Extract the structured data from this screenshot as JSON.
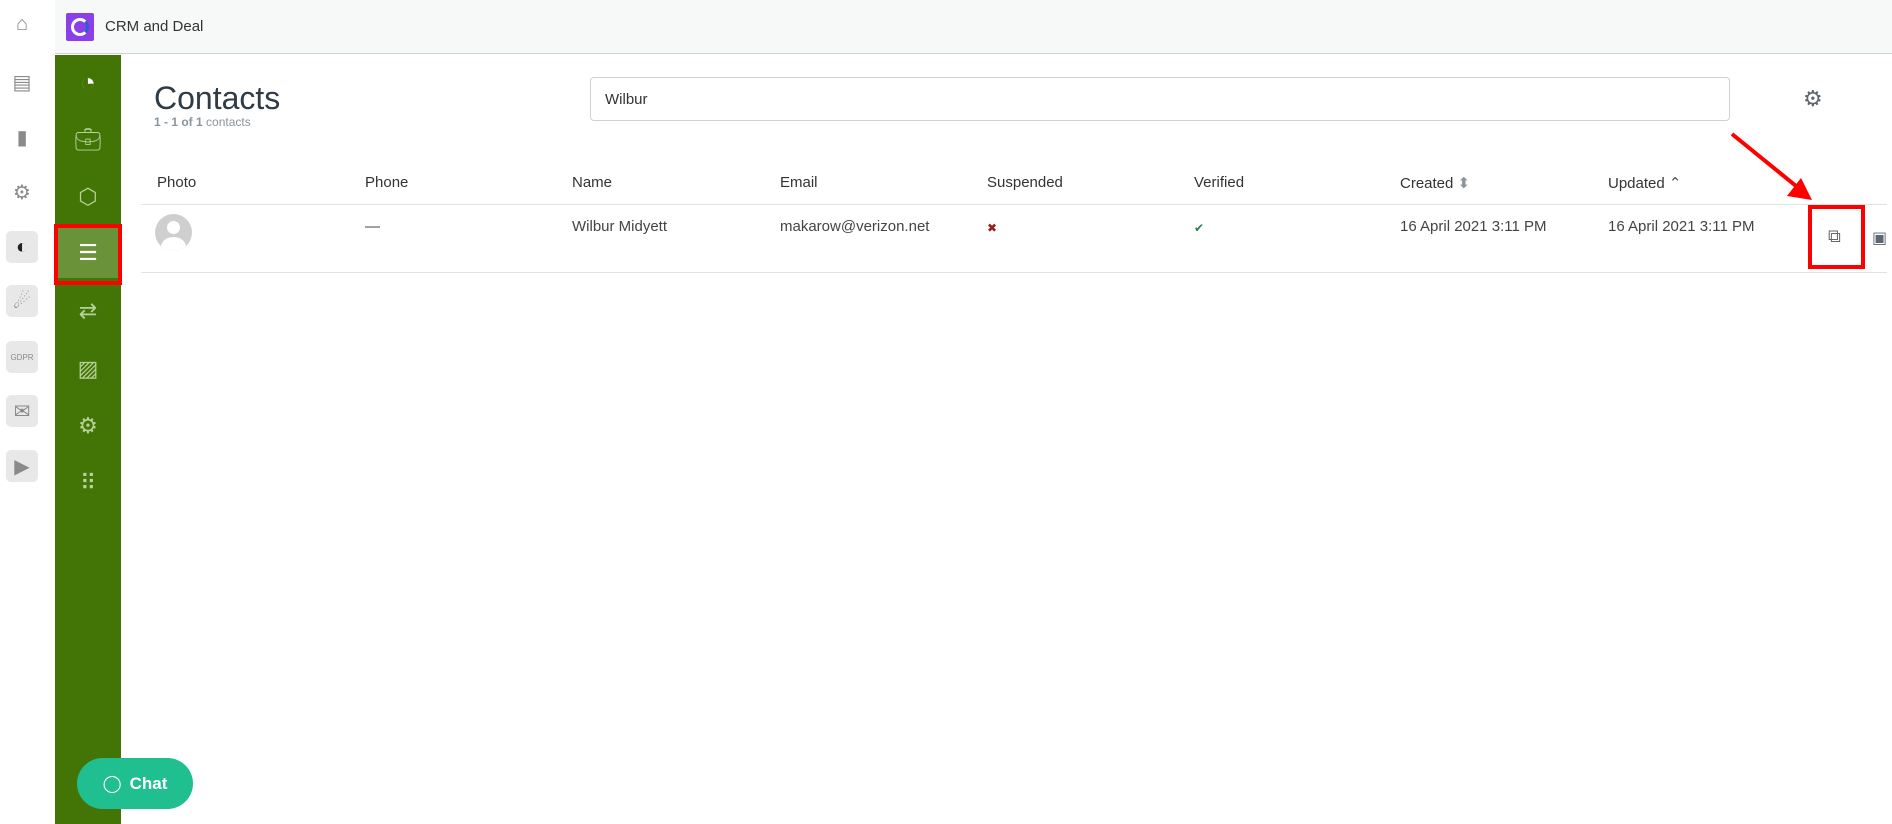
{
  "app": {
    "title": "CRM and Deal"
  },
  "rail": {
    "items": [
      "home-icon",
      "archive-icon",
      "chart-icon",
      "gear-icon",
      "crm-icon",
      "meteor-icon",
      "gdpr-icon",
      "mail-check-icon",
      "video-icon"
    ]
  },
  "sidebar": {
    "items": [
      "crm-logo",
      "deals-icon",
      "products-icon",
      "contacts-icon",
      "transfer-icon",
      "reports-icon",
      "settings-icon",
      "apps-grid-icon"
    ],
    "active": "contacts-icon"
  },
  "page": {
    "title": "Contacts",
    "count_range": "1 - 1 of 1",
    "count_label": "contacts"
  },
  "search": {
    "value": "Wilbur"
  },
  "table": {
    "headers": [
      "Photo",
      "Phone",
      "Name",
      "Email",
      "Suspended",
      "Verified",
      "Created",
      "Updated"
    ],
    "rows": [
      {
        "phone": "—",
        "name": "Wilbur Midyett",
        "email": "makarow@verizon.net",
        "suspended": "✖",
        "verified": "✔",
        "created": "16 April 2021 3:11 PM",
        "updated": "16 April 2021 3:11 PM"
      }
    ]
  },
  "chat": {
    "label": "Chat"
  },
  "colors": {
    "sidebar": "#427505",
    "active": "#6a9238",
    "chat": "#1fbf8f",
    "highlight": "#ff0000",
    "suspended": "#9b1c1c",
    "verified": "#2e7d4f"
  }
}
